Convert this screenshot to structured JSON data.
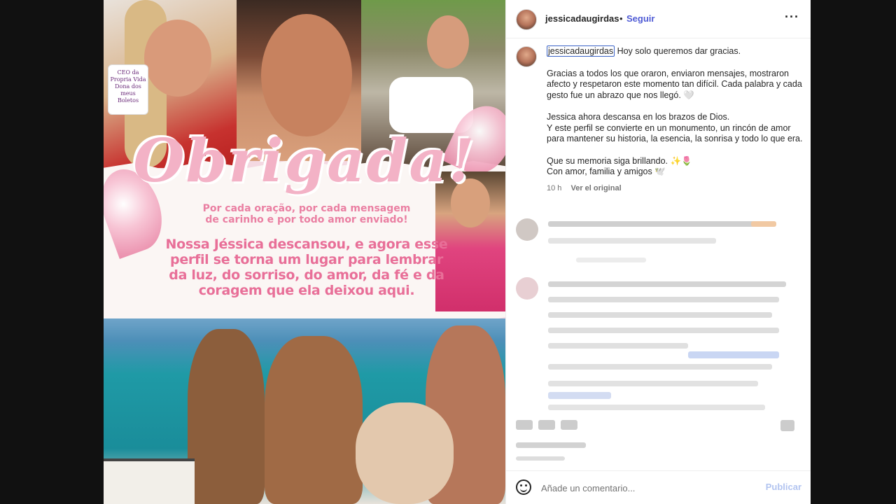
{
  "header": {
    "username": "jessicadaugirdas",
    "dot": "•",
    "follow_label": "Seguir",
    "more_icon": "more-options-icon"
  },
  "media": {
    "mug_text": "CEO da\nPropria Vida\nDona dos meus\nBoletos",
    "title": "Obrigada!",
    "subtitle": "Por cada oração, por cada mensagem de carinho e por todo amor enviado!",
    "message": "Nossa Jéssica descansou, e agora esse perfil se torna um lugar para lembrar da luz, do sorriso, do amor, da fé e da coragem  que ela deixou aqui."
  },
  "caption": {
    "username": "jessicadaugirdas",
    "first_line": " Hoy solo queremos dar gracias.",
    "p1": "Gracias a todos los que oraron, enviaron mensajes, mostraron afecto y respetaron este momento tan difícil. Cada palabra y cada gesto fue un abrazo que nos llegó. 🤍",
    "p2": "Jessica ahora descansa en los brazos de Dios.\nY este perfil se convierte en un monumento, un rincón de amor para mantener su historia, la esencia, la sonrisa y todo lo que era.",
    "p3": "Que su memoria siga brillando. ✨🌷\nCon amor, familia y amigos 🕊️",
    "time": "10 h",
    "see_original": "Ver el original"
  },
  "footer": {
    "emoji_icon": "emoji-icon",
    "comment_placeholder": "Añade un comentario...",
    "publish_label": "Publicar"
  }
}
